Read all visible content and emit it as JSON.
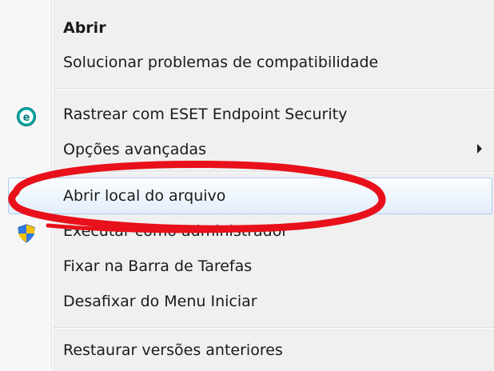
{
  "menu": {
    "items": [
      {
        "label": "Abrir",
        "bold": true
      },
      {
        "label": "Solucionar problemas de compatibilidade"
      },
      {
        "label": "Rastrear com ESET Endpoint Security",
        "icon": "eset-icon"
      },
      {
        "label": "Opções avançadas",
        "submenu": true
      },
      {
        "label": "Abrir local do arquivo",
        "highlighted": true
      },
      {
        "label": "Executar como administrador",
        "icon": "uac-shield-icon"
      },
      {
        "label": "Fixar na Barra de Tarefas"
      },
      {
        "label": "Desafixar do Menu Iniciar"
      },
      {
        "label": "Restaurar versões anteriores"
      }
    ]
  },
  "colors": {
    "eset_teal": "#00a8a8",
    "annotation_red": "#e8101a",
    "hover_border": "#aeccf0"
  }
}
